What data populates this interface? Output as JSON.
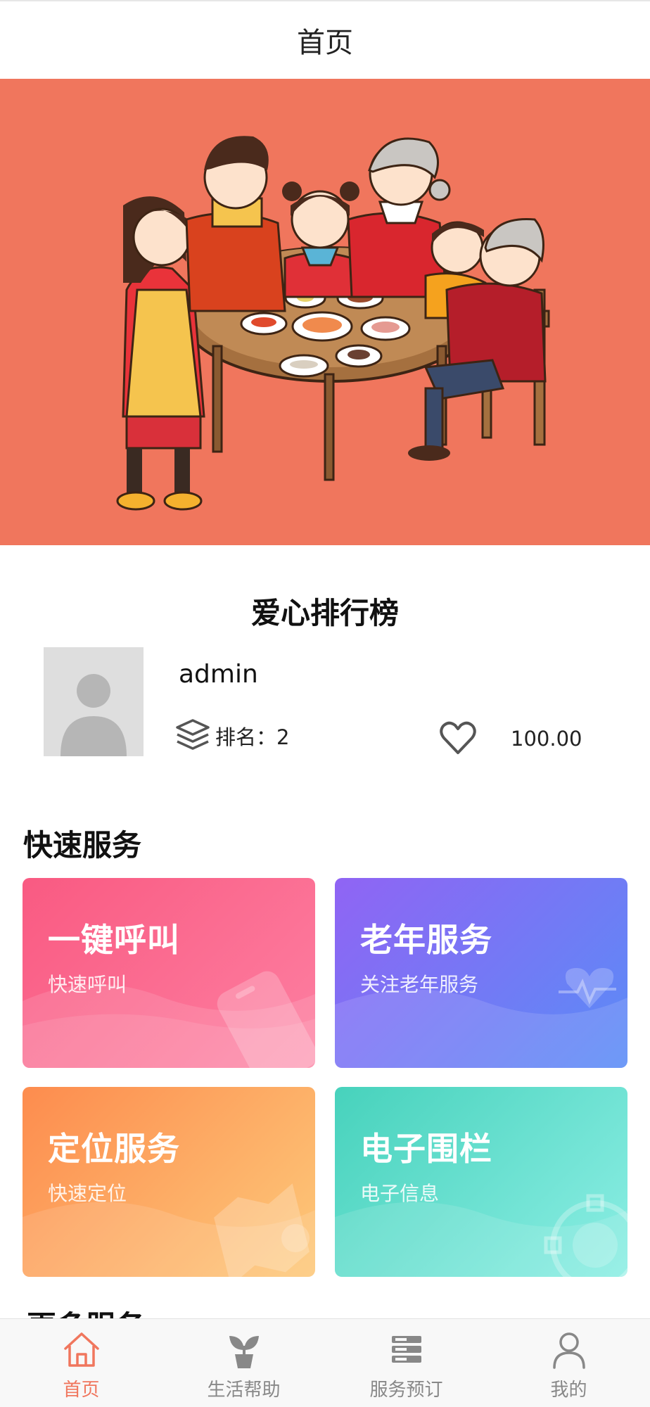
{
  "nav": {
    "title": "首页"
  },
  "banner": {
    "background": "#f0765d"
  },
  "leaderboard": {
    "title": "爱心排行榜",
    "username": "admin",
    "rank_label": "排名：2",
    "score": "100.00"
  },
  "quick_services": {
    "title": "快速服务",
    "cards": [
      {
        "title": "一键呼叫",
        "subtitle": "快速呼叫",
        "color": "#f95a82"
      },
      {
        "title": "老年服务",
        "subtitle": "关注老年服务",
        "color": "#7a6ff5"
      },
      {
        "title": "定位服务",
        "subtitle": "快速定位",
        "color": "#fd9c58"
      },
      {
        "title": "电子围栏",
        "subtitle": "电子信息",
        "color": "#52d8c4"
      }
    ]
  },
  "more_services": {
    "title": "更多服务"
  },
  "tabbar": {
    "active_color": "#f0765d",
    "items": [
      {
        "label": "首页",
        "icon": "home-icon"
      },
      {
        "label": "生活帮助",
        "icon": "plant-icon"
      },
      {
        "label": "服务预订",
        "icon": "server-icon"
      },
      {
        "label": "我的",
        "icon": "person-icon"
      }
    ]
  }
}
